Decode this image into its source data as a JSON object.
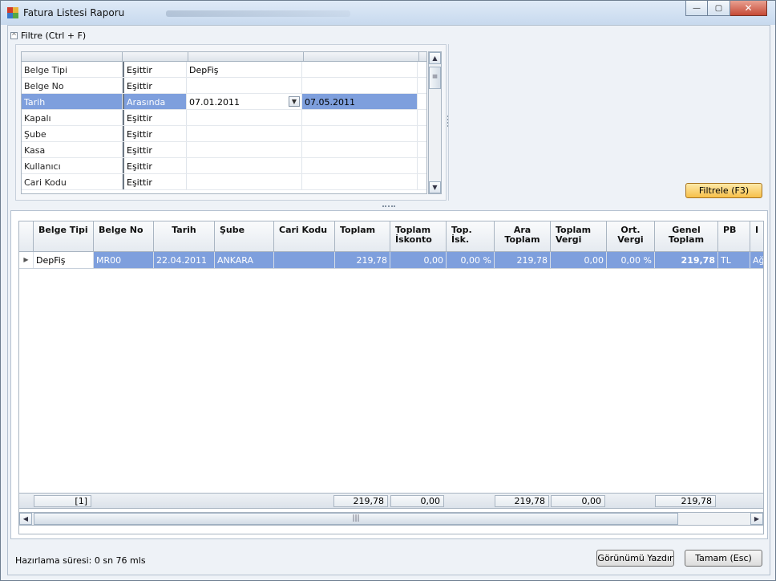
{
  "window": {
    "title": "Fatura Listesi Raporu",
    "minimize": "—",
    "maximize": "▢",
    "close": "✕"
  },
  "filter": {
    "toggle": "^",
    "label": "Filtre (Ctrl + F)",
    "rows": [
      {
        "field": "Belge Tipi",
        "op": "Eşittir",
        "value1": "DepFiş",
        "value2": ""
      },
      {
        "field": "Belge No",
        "op": "Eşittir",
        "value1": "",
        "value2": ""
      },
      {
        "field": "Tarih",
        "op": "Arasında",
        "value1": "07.01.2011",
        "value2": "07.05.2011"
      },
      {
        "field": "Kapalı",
        "op": "Eşittir",
        "value1": "",
        "value2": ""
      },
      {
        "field": "Şube",
        "op": "Eşittir",
        "value1": "",
        "value2": ""
      },
      {
        "field": "Kasa",
        "op": "Eşittir",
        "value1": "",
        "value2": ""
      },
      {
        "field": "Kullanıcı",
        "op": "Eşittir",
        "value1": "",
        "value2": ""
      },
      {
        "field": "Cari Kodu",
        "op": "Eşittir",
        "value1": "",
        "value2": ""
      }
    ],
    "button": "Filtrele (F3)"
  },
  "grid": {
    "columns": {
      "belge_tipi": "Belge Tipi",
      "belge_no": "Belge No",
      "tarih": "Tarih",
      "sube": "Şube",
      "cari_kodu": "Cari Kodu",
      "toplam": "Toplam",
      "toplam_iskonto_1": "Toplam",
      "toplam_iskonto_2": "İskonto",
      "top_isk_1": "Top.",
      "top_isk_2": "İsk.",
      "ara_toplam_1": "Ara",
      "ara_toplam_2": "Toplam",
      "toplam_vergi_1": "Toplam",
      "toplam_vergi_2": "Vergi",
      "ort_vergi_1": "Ort.",
      "ort_vergi_2": "Vergi",
      "genel_toplam_1": "Genel",
      "genel_toplam_2": "Toplam",
      "pb": "PB",
      "cut": "I"
    },
    "rows": [
      {
        "belge_tipi": "DepFiş",
        "belge_no": "MR00",
        "tarih": "22.04.2011",
        "sube": "ANKARA",
        "cari_kodu": "",
        "toplam": "219,78",
        "toplam_iskonto": "0,00",
        "top_isk": "0,00 %",
        "ara_toplam": "219,78",
        "toplam_vergi": "0,00",
        "ort_vergi": "0,00 %",
        "genel_toplam": "219,78",
        "pb": "TL",
        "cut": "Ağ"
      }
    ],
    "footer": {
      "count": "[1]",
      "toplam": "219,78",
      "toplam_iskonto": "0,00",
      "ara_toplam": "219,78",
      "toplam_vergi": "0,00",
      "genel_toplam": "219,78"
    },
    "row_indicator": "▶",
    "scroll_grip": "|||"
  },
  "status": {
    "text": "Hazırlama süresi: 0 sn 76 mls"
  },
  "buttons": {
    "print": "Görünümü Yazdır",
    "ok": "Tamam (Esc)"
  }
}
